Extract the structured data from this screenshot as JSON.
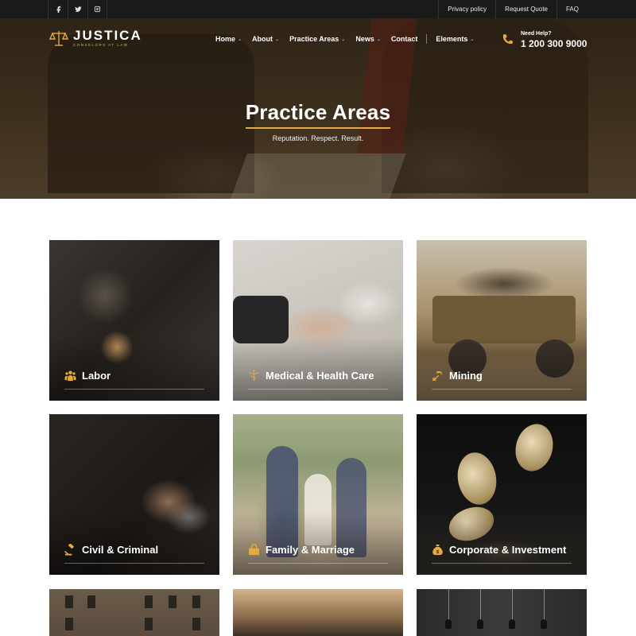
{
  "topbar": {
    "socials": [
      {
        "icon": "facebook-icon"
      },
      {
        "icon": "twitter-icon"
      },
      {
        "icon": "instagram-icon"
      }
    ],
    "links": [
      "Privacy policy",
      "Request Quote",
      "FAQ"
    ]
  },
  "header": {
    "brand": "JUSTICA",
    "tagline": "CONSELORS AT LAW",
    "logo_icon": "scales-icon",
    "nav": [
      {
        "label": "Home",
        "dropdown": true
      },
      {
        "label": "About",
        "dropdown": true
      },
      {
        "label": "Practice Areas",
        "dropdown": true
      },
      {
        "label": "News",
        "dropdown": true
      },
      {
        "label": "Contact",
        "dropdown": false
      },
      {
        "label": "Elements",
        "dropdown": true
      }
    ],
    "help_label": "Need Help?",
    "phone": "1 200 300 9000",
    "phone_icon": "phone-icon"
  },
  "hero": {
    "title": "Practice Areas",
    "subtitle": "Reputation. Respect. Result."
  },
  "cards": [
    {
      "label": "Labor",
      "icon": "people-icon"
    },
    {
      "label": "Medical & Health Care",
      "icon": "caduceus-icon"
    },
    {
      "label": "Mining",
      "icon": "pickaxe-icon"
    },
    {
      "label": "Civil & Criminal",
      "icon": "gavel-icon"
    },
    {
      "label": "Family & Marriage",
      "icon": "family-icon"
    },
    {
      "label": "Corporate & Investment",
      "icon": "money-bag-icon"
    }
  ],
  "colors": {
    "accent": "#e6a93a",
    "topbar": "#1a1a1a"
  }
}
